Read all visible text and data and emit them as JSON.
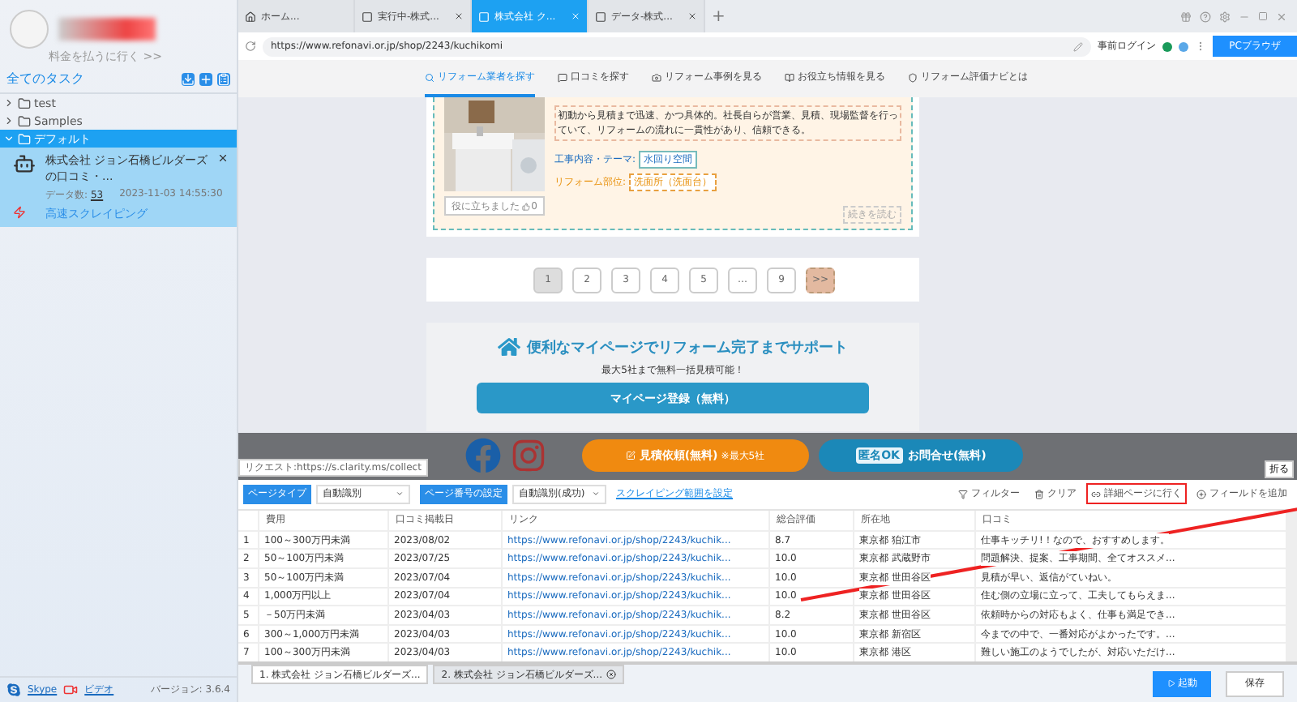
{
  "sidebar": {
    "account_link": "料金を払うに行く >>",
    "tasks_title": "全てのタスク",
    "folders": [
      {
        "label": "test",
        "expanded": false,
        "selected": false
      },
      {
        "label": "Samples",
        "expanded": false,
        "selected": false
      },
      {
        "label": "デフォルト",
        "expanded": true,
        "selected": true,
        "tasks": [
          {
            "title": "株式会社 ジョン石橋ビルダーズの口コミ・...",
            "count_label": "データ数:",
            "count": "53",
            "time": "2023-11-03 14:55:30",
            "mode": "高速スクレイピング"
          }
        ]
      }
    ],
    "footer": {
      "skype": "Skype",
      "video": "ビデオ",
      "version": "バージョン: 3.6.4"
    }
  },
  "browser_tabs": [
    {
      "label": "ホーム...",
      "kind": "home",
      "selected": false,
      "closable": false
    },
    {
      "label": "実行中-株式...",
      "kind": "page",
      "selected": false,
      "closable": true
    },
    {
      "label": "株式会社 ク...",
      "kind": "page",
      "selected": true,
      "closable": true
    },
    {
      "label": "データ-株式...",
      "kind": "page",
      "selected": false,
      "closable": true
    }
  ],
  "new_tab": "+",
  "address_bar": {
    "url": "https://www.refonavi.or.jp/shop/2243/kuchikomi",
    "login": "事前ログイン",
    "browser_button": "PCブラウザ"
  },
  "web_page": {
    "nav": [
      {
        "label": "リフォーム業者を探す",
        "kind": "search",
        "selected": true
      },
      {
        "label": "口コミを探す",
        "kind": "comment",
        "selected": false
      },
      {
        "label": "リフォーム事例を見る",
        "kind": "camera",
        "selected": false
      },
      {
        "label": "お役立ち情報を見る",
        "kind": "book",
        "selected": false
      },
      {
        "label": "リフォーム評価ナビとは",
        "kind": "shield",
        "selected": false
      }
    ],
    "review": {
      "text": "初動から見積まで迅速、かつ具体的。社長自らが営業、見積、現場監督を行っていて、リフォームの流れに一貫性があり、信頼できる。",
      "tags": [
        {
          "label": "工事内容・テーマ:",
          "value": "水回り空間",
          "kind": "theme"
        },
        {
          "label": "リフォーム部位:",
          "value": "洗面所（洗面台）",
          "kind": "part"
        }
      ],
      "helpful": "役に立ちました",
      "helpful_count": "0",
      "read_more": "続きを読む"
    },
    "pagination": [
      {
        "label": "1",
        "selected": true
      },
      {
        "label": "2",
        "selected": false
      },
      {
        "label": "3",
        "selected": false
      },
      {
        "label": "4",
        "selected": false
      },
      {
        "label": "5",
        "selected": false
      },
      {
        "label": "…",
        "selected": false
      },
      {
        "label": "9",
        "selected": false
      },
      {
        "label": ">>",
        "selected": false
      }
    ],
    "promo": {
      "title": "便利なマイページでリフォーム完了までサポート",
      "subtitle": "最大5社まで無料一括見積可能！",
      "button": "マイページ登録（無料）"
    },
    "footer": {
      "estimate": "見積依頼(無料)",
      "estimate_note": "※最大5社",
      "contact_badge": "匿名OK",
      "contact": "お問合せ(無料)"
    },
    "request_status": "リクエスト:https://s.clarity.ms/collect",
    "fold": "折る"
  },
  "toolbar": {
    "selects": [
      {
        "label": "ページタイプ",
        "value": "自動識別"
      },
      {
        "label": "ページ番号の設定",
        "value": "自動識別(成功)"
      }
    ],
    "range_link": "スクレイピング範囲を設定",
    "tools": [
      {
        "label": "フィルター",
        "kind": "filter",
        "highlighted": false
      },
      {
        "label": "クリア",
        "kind": "clear",
        "highlighted": false
      },
      {
        "label": "詳細ページに行く",
        "kind": "link",
        "highlighted": true
      },
      {
        "label": "フィールドを追加",
        "kind": "add",
        "highlighted": false
      }
    ]
  },
  "table": {
    "columns": [
      "費用",
      "口コミ掲載日",
      "リンク",
      "総合評価",
      "所在地",
      "口コミ"
    ],
    "rows": [
      {
        "index": "1",
        "cells": [
          "100～300万円未満",
          "2023/08/02",
          "https://www.refonavi.or.jp/shop/2243/kuchik...",
          "8.7",
          "東京都 狛江市",
          "仕事キッチリ!！なので、おすすめします。"
        ]
      },
      {
        "index": "2",
        "cells": [
          "50～100万円未満",
          "2023/07/25",
          "https://www.refonavi.or.jp/shop/2243/kuchik...",
          "10.0",
          "東京都 武蔵野市",
          "問題解決、提案、工事期間、全てオススメ..."
        ]
      },
      {
        "index": "3",
        "cells": [
          "50～100万円未満",
          "2023/07/04",
          "https://www.refonavi.or.jp/shop/2243/kuchik...",
          "10.0",
          "東京都 世田谷区",
          "見積が早い、返信がていねい。"
        ]
      },
      {
        "index": "4",
        "cells": [
          "1,000万円以上",
          "2023/07/04",
          "https://www.refonavi.or.jp/shop/2243/kuchik...",
          "10.0",
          "東京都 世田谷区",
          "住む側の立場に立って、工夫してもらえま..."
        ]
      },
      {
        "index": "5",
        "cells": [
          "－50万円未満",
          "2023/04/03",
          "https://www.refonavi.or.jp/shop/2243/kuchik...",
          "8.2",
          "東京都 世田谷区",
          "依頼時からの対応もよく、仕事も満足でき..."
        ]
      },
      {
        "index": "6",
        "cells": [
          "300～1,000万円未満",
          "2023/04/03",
          "https://www.refonavi.or.jp/shop/2243/kuchik...",
          "10.0",
          "東京都 新宿区",
          "今までの中で、一番対応がよかったです。..."
        ]
      },
      {
        "index": "7",
        "cells": [
          "100～300万円未満",
          "2023/04/03",
          "https://www.refonavi.or.jp/shop/2243/kuchik...",
          "10.0",
          "東京都 港区",
          "難しい施工のようでしたが、対応いただけ..."
        ]
      }
    ]
  },
  "result_tabs": [
    {
      "label": "1. 株式会社 ジョン石橋ビルダーズ...",
      "selected": true,
      "closable": false
    },
    {
      "label": "2. 株式会社 ジョン石橋ビルダーズ...",
      "selected": false,
      "closable": true
    }
  ],
  "actions": [
    {
      "label": "起動",
      "kind": "primary"
    },
    {
      "label": "保存",
      "kind": "secondary"
    }
  ]
}
